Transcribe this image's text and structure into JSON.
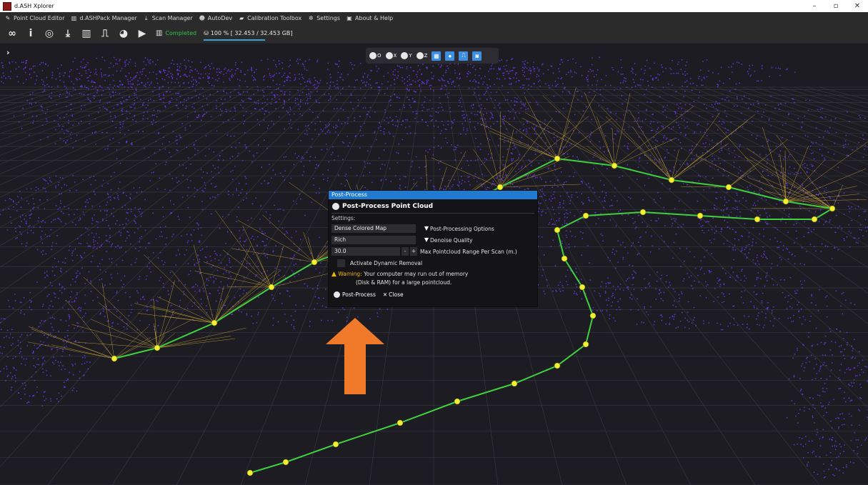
{
  "window": {
    "title": "d.ASH Xplorer",
    "controls": {
      "minimize": "–",
      "maximize": "▫",
      "close": "✕"
    }
  },
  "menu": {
    "items": [
      {
        "label": "Point Cloud Editor",
        "icon": "edit-icon"
      },
      {
        "label": "d.ASHPack Manager",
        "icon": "map-icon"
      },
      {
        "label": "Scan Manager",
        "icon": "download-icon"
      },
      {
        "label": "AutoDev",
        "icon": "robot-icon"
      },
      {
        "label": "Calibration Toolbox",
        "icon": "toolbox-icon"
      },
      {
        "label": "Settings",
        "icon": "gear-icon"
      },
      {
        "label": "About & Help",
        "icon": "help-icon"
      }
    ]
  },
  "toolbar": {
    "icons": [
      "link-icon",
      "info-icon",
      "target-icon",
      "download-icon",
      "map-icon",
      "signal-icon",
      "palette-icon",
      "export-icon"
    ],
    "status_label": "Completed",
    "progress_text": "100 %  [ 32.453 / 32.453 GB]",
    "progress_fraction": 1.0
  },
  "view_toolbar": {
    "buttons": [
      {
        "label": "O",
        "icon": "globe-icon"
      },
      {
        "label": "X",
        "icon": "view-x-icon"
      },
      {
        "label": "Y",
        "icon": "view-y-icon"
      },
      {
        "label": "Z",
        "icon": "view-z-icon"
      }
    ],
    "toggles": [
      "grid-icon",
      "color-icon",
      "trajectory-icon",
      "camera-icon"
    ]
  },
  "dialog": {
    "window_title": "Post-Process",
    "header": "Post-Process Point Cloud",
    "settings_label": "Settings:",
    "options": {
      "post_processing_value": "Dense Colored Map",
      "post_processing_label": "Post-Processing Options",
      "denoise_value": "Rich",
      "denoise_label": "Denoise Quality",
      "range_value": "30.0",
      "range_minus": "-",
      "range_plus": "+",
      "range_label": "Max Pointcloud Range Per Scan (m.)",
      "dynamic_removal_label": "Activate Dynamic Removal"
    },
    "warning": {
      "label": "Warning:",
      "line1": "Your computer may run out of memory",
      "line2": "(Disk & RAM) for a large pointcloud."
    },
    "buttons": {
      "post_process": "Post-Process",
      "close": "Close"
    }
  },
  "colors": {
    "points": "#6a3cf0",
    "edges": "#f2c23a",
    "trajectory": "#3fcf3f",
    "nodes": "#f4f034",
    "arrow": "#f07a2a",
    "accent": "#1f7ad0"
  }
}
